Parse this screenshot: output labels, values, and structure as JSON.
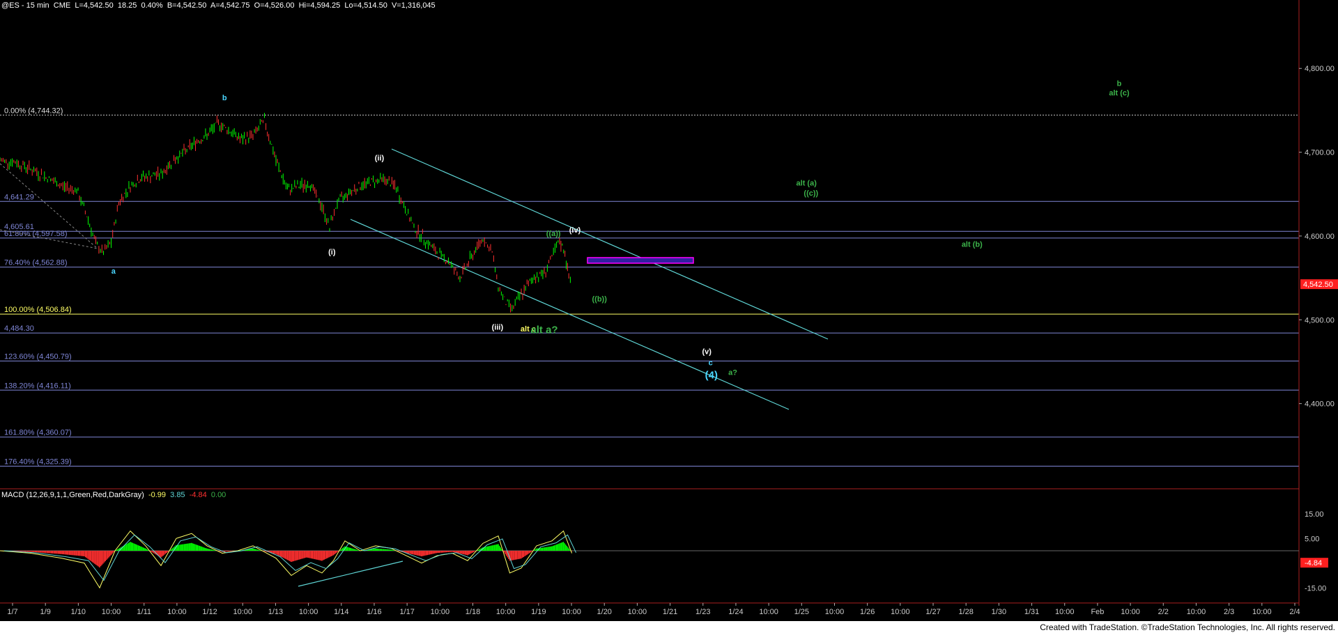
{
  "header": {
    "symbol": "@ES - 15 min",
    "exchange": "CME",
    "last": "L=4,542.50",
    "change": "18.25",
    "pct": "0.40%",
    "bid": "B=4,542.50",
    "ask": "A=4,542.75",
    "open": "O=4,526.00",
    "hi": "Hi=4,594.25",
    "lo": "Lo=4,514.50",
    "vol": "V=1,316,045"
  },
  "macd_header": {
    "label": "MACD (12,26,9,1,1,Green,Red,DarkGray)",
    "v1": "-0.99",
    "v2": "3.85",
    "v3": "-4.84",
    "v4": "0.00"
  },
  "footer": "Created with TradeStation. ©TradeStation Technologies, Inc. All rights reserved.",
  "colors": {
    "background": "#000000",
    "up_bar": "#00ff00",
    "down_bar": "#ff3030",
    "channel": "#5fd6d6",
    "fib": "#7f86d6",
    "fib_yellow": "#ffff66",
    "accent_green": "#3cb34a",
    "wave_cyan": "#4ad6ff"
  },
  "chart_data": {
    "type": "line",
    "title": "@ES - 15 min",
    "price_axis": {
      "ticks": [
        "4,800.00",
        "4,700.00",
        "4,600.00",
        "4,500.00",
        "4,400.00"
      ],
      "tick_values": [
        4800,
        4700,
        4600,
        4500,
        4400
      ],
      "last_price_label": "4,542.50",
      "ylim": [
        4300,
        4870
      ]
    },
    "time_axis": {
      "ticks": [
        "1/7",
        "1/9",
        "1/10",
        "10:00",
        "1/11",
        "10:00",
        "1/12",
        "10:00",
        "1/13",
        "10:00",
        "1/14",
        "1/16",
        "1/17",
        "10:00",
        "1/18",
        "10:00",
        "1/19",
        "10:00",
        "1/20",
        "10:00",
        "1/21",
        "1/23",
        "1/24",
        "10:00",
        "1/25",
        "10:00",
        "1/26",
        "10:00",
        "1/27",
        "1/28",
        "1/30",
        "1/31",
        "10:00",
        "Feb",
        "10:00",
        "2/2",
        "10:00",
        "2/3",
        "10:00",
        "2/4"
      ]
    },
    "fib_levels": [
      {
        "label": "0.00% (4,744.32)",
        "value": 4744.32
      },
      {
        "label": "4,641.29",
        "value": 4641.29
      },
      {
        "label": "4,605.61",
        "value": 4605.61
      },
      {
        "label": "61.80% (4,597.58)",
        "value": 4597.58
      },
      {
        "label": "76.40% (4,562.88)",
        "value": 4562.88
      },
      {
        "label": "100.00% (4,506.84)",
        "value": 4506.84
      },
      {
        "label": "4,484.30",
        "value": 4484.3
      },
      {
        "label": "123.60% (4,450.79)",
        "value": 4450.79
      },
      {
        "label": "138.20% (4,416.11)",
        "value": 4416.11
      },
      {
        "label": "161.80% (4,360.07)",
        "value": 4360.07
      },
      {
        "label": "176.40% (4,325.39)",
        "value": 4325.39
      }
    ],
    "price_path": [
      [
        0,
        4690
      ],
      [
        20,
        4688
      ],
      [
        40,
        4680
      ],
      [
        60,
        4670
      ],
      [
        80,
        4660
      ],
      [
        100,
        4655
      ],
      [
        115,
        4620
      ],
      [
        125,
        4590
      ],
      [
        135,
        4580
      ],
      [
        145,
        4592
      ],
      [
        155,
        4640
      ],
      [
        170,
        4660
      ],
      [
        185,
        4670
      ],
      [
        200,
        4672
      ],
      [
        212,
        4675
      ],
      [
        225,
        4690
      ],
      [
        240,
        4700
      ],
      [
        255,
        4712
      ],
      [
        270,
        4720
      ],
      [
        285,
        4735
      ],
      [
        300,
        4725
      ],
      [
        315,
        4715
      ],
      [
        330,
        4720
      ],
      [
        345,
        4738
      ],
      [
        360,
        4690
      ],
      [
        375,
        4655
      ],
      [
        390,
        4660
      ],
      [
        405,
        4662
      ],
      [
        420,
        4635
      ],
      [
        430,
        4610
      ],
      [
        440,
        4640
      ],
      [
        455,
        4652
      ],
      [
        470,
        4660
      ],
      [
        485,
        4665
      ],
      [
        500,
        4668
      ],
      [
        515,
        4660
      ],
      [
        525,
        4640
      ],
      [
        540,
        4610
      ],
      [
        555,
        4595
      ],
      [
        570,
        4580
      ],
      [
        585,
        4570
      ],
      [
        600,
        4550
      ],
      [
        615,
        4575
      ],
      [
        630,
        4598
      ],
      [
        642,
        4580
      ],
      [
        650,
        4540
      ],
      [
        660,
        4520
      ],
      [
        668,
        4514
      ],
      [
        680,
        4530
      ],
      [
        695,
        4550
      ],
      [
        710,
        4556
      ],
      [
        722,
        4578
      ],
      [
        730,
        4594
      ],
      [
        737,
        4580
      ],
      [
        742,
        4550
      ],
      [
        746,
        4542
      ]
    ],
    "macd_path": [
      [
        0,
        0
      ],
      [
        40,
        -1
      ],
      [
        80,
        -3
      ],
      [
        110,
        -5
      ],
      [
        130,
        -15
      ],
      [
        150,
        0
      ],
      [
        170,
        8
      ],
      [
        190,
        2
      ],
      [
        210,
        -6
      ],
      [
        230,
        5
      ],
      [
        250,
        7
      ],
      [
        270,
        2
      ],
      [
        290,
        -1
      ],
      [
        310,
        0
      ],
      [
        330,
        2
      ],
      [
        360,
        -3
      ],
      [
        380,
        -10
      ],
      [
        400,
        -6
      ],
      [
        420,
        -9
      ],
      [
        435,
        -4
      ],
      [
        450,
        4
      ],
      [
        470,
        0
      ],
      [
        490,
        2
      ],
      [
        510,
        1
      ],
      [
        530,
        -2
      ],
      [
        550,
        -5
      ],
      [
        570,
        -2
      ],
      [
        590,
        -1
      ],
      [
        610,
        -4
      ],
      [
        630,
        3
      ],
      [
        650,
        6
      ],
      [
        665,
        -9
      ],
      [
        680,
        -7
      ],
      [
        700,
        2
      ],
      [
        720,
        4
      ],
      [
        735,
        8
      ],
      [
        746,
        -1
      ]
    ],
    "macd_axis": {
      "ticks": [
        "15.00",
        "5.00",
        "-4.84",
        "-15.00"
      ],
      "tick_values": [
        15,
        5,
        -4.84,
        -15
      ],
      "ylim": [
        -20,
        20
      ]
    },
    "wave_labels": [
      {
        "text": "b",
        "color": "#4ad6ff",
        "value_x": 293,
        "value_y": 4762
      },
      {
        "text": "a",
        "color": "#4ad6ff",
        "value_x": 148,
        "value_y": 4555
      },
      {
        "text": "(ii)",
        "color": "#ffffff",
        "value_x": 495,
        "value_y": 4690
      },
      {
        "text": "(i)",
        "color": "#ffffff",
        "value_x": 433,
        "value_y": 4578
      },
      {
        "text": "((a))",
        "color": "#3cb34a",
        "value_x": 722,
        "value_y": 4600
      },
      {
        "text": "(iv)",
        "color": "#ffffff",
        "value_x": 750,
        "value_y": 4604
      },
      {
        "text": "((b))",
        "color": "#3cb34a",
        "value_x": 782,
        "value_y": 4522
      },
      {
        "text": "(iii)",
        "color": "#ffffff",
        "value_x": 649,
        "value_y": 4488
      },
      {
        "text": "alt c",
        "color": "#ffff66",
        "value_x": 689,
        "value_y": 4486
      },
      {
        "text": "alt a?",
        "color": "#3cb34a",
        "value_x": 710,
        "value_y": 4484
      },
      {
        "text": "(v)",
        "color": "#ffffff",
        "value_x": 922,
        "value_y": 4459
      },
      {
        "text": "c",
        "color": "#4ad6ff",
        "value_x": 927,
        "value_y": 4446
      },
      {
        "text": "(4)",
        "color": "#4ad6ff",
        "value_x": 928,
        "value_y": 4430
      },
      {
        "text": "a?",
        "color": "#3cb34a",
        "value_x": 956,
        "value_y": 4434
      },
      {
        "text": "alt (a)",
        "color": "#3cb34a",
        "value_x": 1052,
        "value_y": 4660
      },
      {
        "text": "((c))",
        "color": "#3cb34a",
        "value_x": 1058,
        "value_y": 4648
      },
      {
        "text": "alt (b)",
        "color": "#3cb34a",
        "value_x": 1268,
        "value_y": 4587
      },
      {
        "text": "b",
        "color": "#3cb34a",
        "value_x": 1460,
        "value_y": 4779
      },
      {
        "text": "alt (c)",
        "color": "#3cb34a",
        "value_x": 1460,
        "value_y": 4768
      }
    ]
  }
}
